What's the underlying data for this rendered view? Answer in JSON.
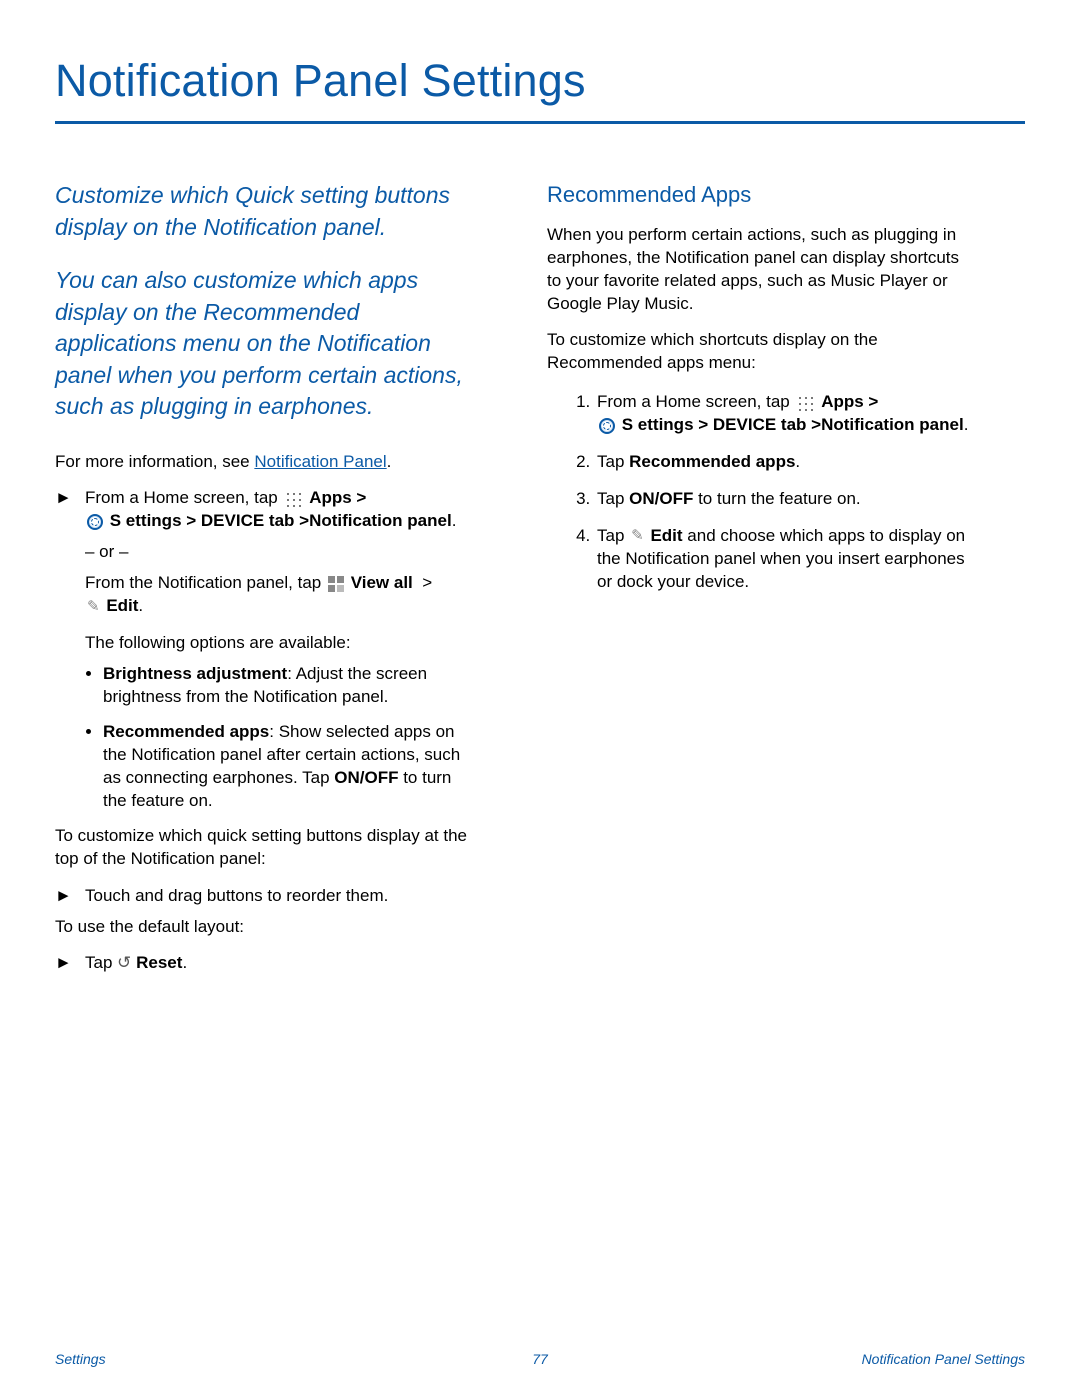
{
  "title": "Notification Panel Settings",
  "intro1": "Customize which Quick setting buttons display on the Notification panel.",
  "intro2": "You can also customize which apps display on the Recommended applications menu on the Notification panel when you perform certain actions, such as plugging in earphones.",
  "moreinfo_prefix": "For more information, see ",
  "moreinfo_link": "Notification Panel",
  "step_home_prefix": "From a Home screen, tap ",
  "apps_label": "Apps",
  "gt": " > ",
  "settings_label": "S ettings",
  "device_tab_path": " > DEVICE tab >Notification panel",
  "or": "– or –",
  "from_panel_prefix": "From the Notification panel, tap ",
  "viewall_label": "View all",
  "edit_label": "Edit",
  "options_intro": "The following options are available:",
  "opt1_label": "Brightness adjustment",
  "opt1_text": ": Adjust the screen brightness from the Notification panel.",
  "opt2_label": "Recommended apps",
  "opt2_text_a": ": Show selected apps on the Notification panel after certain actions, such as connecting earphones. Tap ",
  "onoff": "ON/OFF",
  "opt2_text_b": " to turn the feature on.",
  "customize_quick": "To customize which quick setting buttons display at the top of the Notification panel:",
  "drag_step": "Touch and drag buttons to reorder them.",
  "default_layout": "To use the default layout:",
  "tap": "Tap ",
  "reset_label": " Reset",
  "period": ".",
  "h2": "Recommended Apps",
  "rec_p1": "When you perform certain actions, such as plugging in earphones, the Notification panel can display shortcuts to your favorite related apps, such as Music Player or Google Play Music.",
  "rec_p2": "To customize which shortcuts display on the Recommended apps menu:",
  "li2_a": "Tap ",
  "li2_b": "Recommended apps",
  "li3_a": "Tap ",
  "li3_b": " to turn the feature on.",
  "li4_a": "Tap ",
  "li4_b": " and choose which apps to display on the Notification panel when you insert earphones or dock your device.",
  "footer_left": "Settings",
  "footer_center": "77",
  "footer_right": "Notification Panel Settings"
}
